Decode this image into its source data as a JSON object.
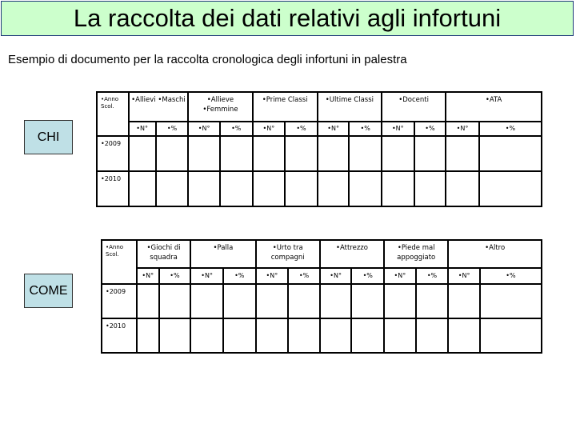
{
  "header": {
    "title": "La raccolta dei dati relativi agli infortuni",
    "subtitle": "Esempio di documento per la raccolta cronologica degli infortuni in palestra"
  },
  "colors": {
    "title_bg": "#ccffcc",
    "title_border": "#1f3a7a",
    "label_box_bg": "#bfe0e6"
  },
  "chi_section": {
    "label": "CHI",
    "year_header": "•Anno Scol.",
    "groups": [
      {
        "label": "•Allievi •Maschi"
      },
      {
        "label": "•Allieve •Femmine"
      },
      {
        "label": "•Prime Classi"
      },
      {
        "label": "•Ultime Classi"
      },
      {
        "label": "•Docenti"
      },
      {
        "label": "•ATA"
      }
    ],
    "sub_headers": [
      "•N°",
      "•%"
    ],
    "rows": [
      {
        "year": "•2009",
        "cells": [
          "",
          "",
          "",
          "",
          "",
          "",
          "",
          "",
          "",
          "",
          "",
          ""
        ]
      },
      {
        "year": "•2010",
        "cells": [
          "",
          "",
          "",
          "",
          "",
          "",
          "",
          "",
          "",
          "",
          "",
          ""
        ]
      }
    ]
  },
  "come_section": {
    "label": "COME",
    "year_header": "•Anno Scol.",
    "groups": [
      {
        "label": "•Giochi di squadra"
      },
      {
        "label": "•Palla"
      },
      {
        "label": "•Urto tra compagni"
      },
      {
        "label": "•Attrezzo"
      },
      {
        "label": "•Piede mal appoggiato"
      },
      {
        "label": "•Altro"
      }
    ],
    "sub_headers": [
      "•N°",
      "•%"
    ],
    "rows": [
      {
        "year": "•2009",
        "cells": [
          "",
          "",
          "",
          "",
          "",
          "",
          "",
          "",
          "",
          "",
          "",
          ""
        ]
      },
      {
        "year": "•2010",
        "cells": [
          "",
          "",
          "",
          "",
          "",
          "",
          "",
          "",
          "",
          "",
          "",
          ""
        ]
      }
    ]
  }
}
